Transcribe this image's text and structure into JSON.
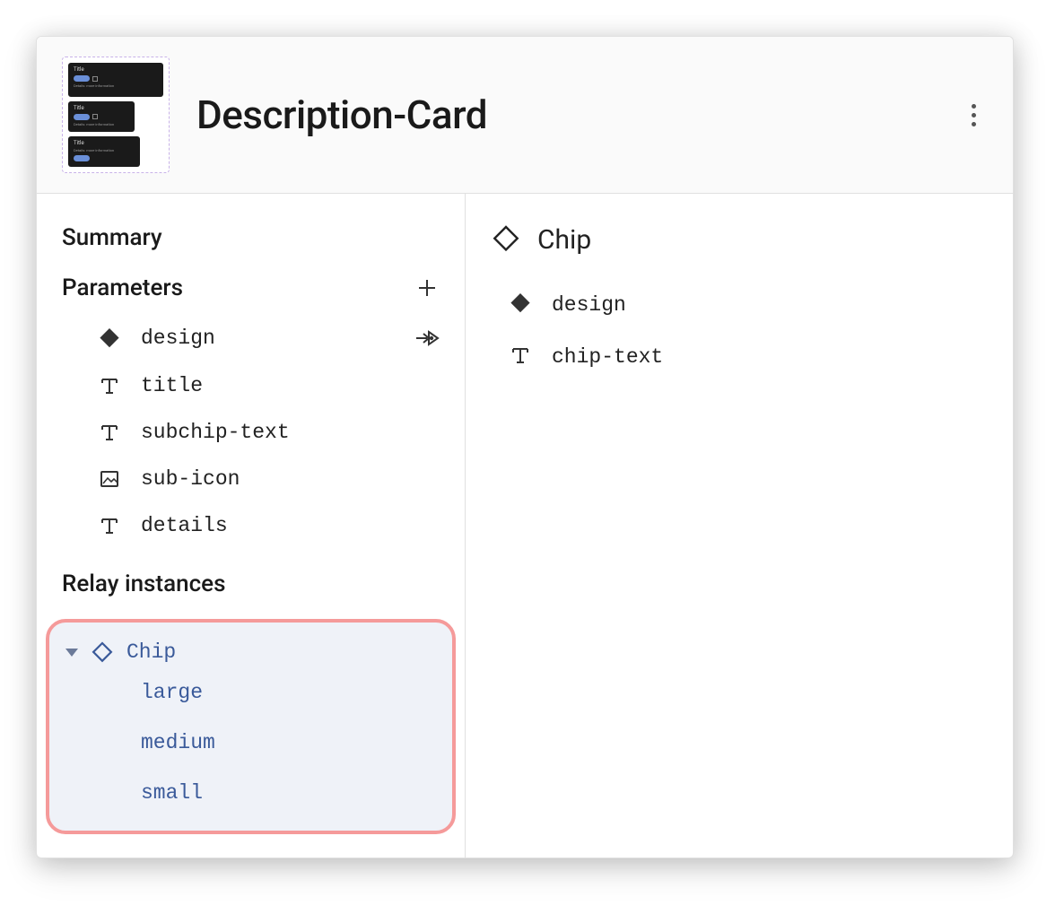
{
  "header": {
    "title": "Description-Card"
  },
  "leftPane": {
    "summaryHeading": "Summary",
    "parametersHeading": "Parameters",
    "parameters": [
      {
        "icon": "diamond-filled",
        "label": "design",
        "action": "map"
      },
      {
        "icon": "text",
        "label": "title"
      },
      {
        "icon": "text",
        "label": "subchip-text"
      },
      {
        "icon": "image",
        "label": "sub-icon"
      },
      {
        "icon": "text",
        "label": "details"
      }
    ],
    "relayHeading": "Relay instances",
    "relayInstance": {
      "icon": "diamond-outline",
      "label": "Chip",
      "children": [
        "large",
        "medium",
        "small"
      ]
    }
  },
  "rightPane": {
    "headerIcon": "diamond-outline",
    "title": "Chip",
    "items": [
      {
        "icon": "diamond-filled",
        "label": "design"
      },
      {
        "icon": "text",
        "label": "chip-text"
      }
    ]
  }
}
